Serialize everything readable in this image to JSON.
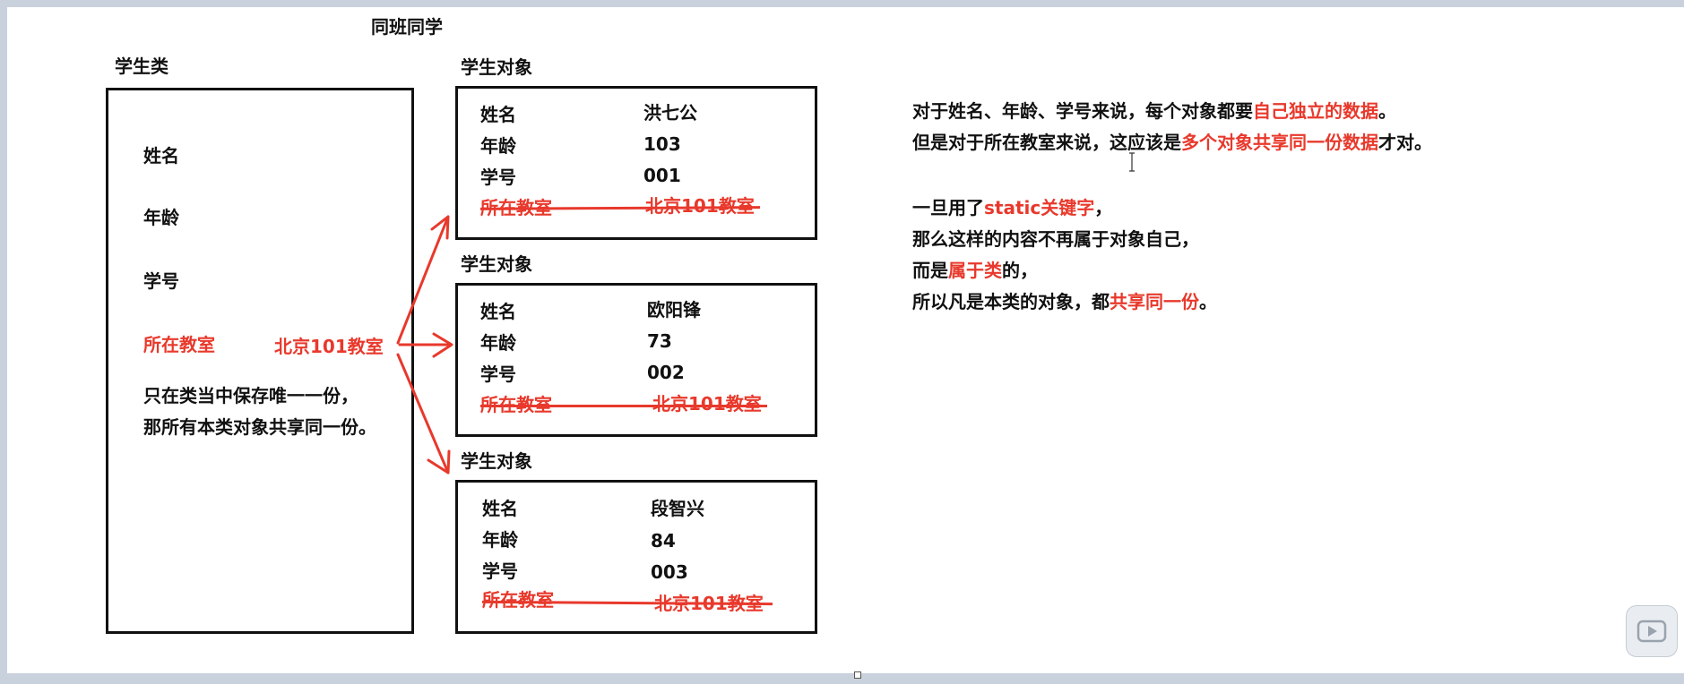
{
  "title": "同班同学",
  "class_panel": {
    "label": "学生类",
    "fields": [
      "姓名",
      "年龄",
      "学号"
    ],
    "static_field": "所在教室",
    "static_value": "北京101教室",
    "note_lines": [
      "只在类当中保存唯一一份，",
      "那所有本类对象共享同一份。"
    ]
  },
  "objects": [
    {
      "label": "学生对象",
      "name_key": "姓名",
      "name_val": "洪七公",
      "age_key": "年龄",
      "age_val": "103",
      "id_key": "学号",
      "id_val": "001",
      "room_key": "所在教室",
      "room_val": "北京101教室"
    },
    {
      "label": "学生对象",
      "name_key": "姓名",
      "name_val": "欧阳锋",
      "age_key": "年龄",
      "age_val": "73",
      "id_key": "学号",
      "id_val": "002",
      "room_key": "所在教室",
      "room_val": "北京101教室"
    },
    {
      "label": "学生对象",
      "name_key": "姓名",
      "name_val": "段智兴",
      "age_key": "年龄",
      "age_val": "84",
      "id_key": "学号",
      "id_val": "003",
      "room_key": "所在教室",
      "room_val": "北京101教室"
    }
  ],
  "explanation": {
    "l1_a": "对于姓名、年龄、学号来说，每个对象都要",
    "l1_b": "自己独立的数据",
    "l1_c": "。",
    "l2_a": "但是对于所在教室来说，这应该是",
    "l2_b": "多个对象共享同一份数据",
    "l2_c": "才对。",
    "l3_a": "一旦用了",
    "l3_b": "static关键字",
    "l3_c": "，",
    "l4": "那么这样的内容不再属于对象自己，",
    "l5_a": "而是",
    "l5_b": "属于类",
    "l5_c": "的，",
    "l6_a": "所以凡是本类的对象，都",
    "l6_b": "共享同一份",
    "l6_c": "。"
  },
  "colors": {
    "accent": "#e8392c",
    "text": "#111111",
    "background": "#ffffff"
  }
}
